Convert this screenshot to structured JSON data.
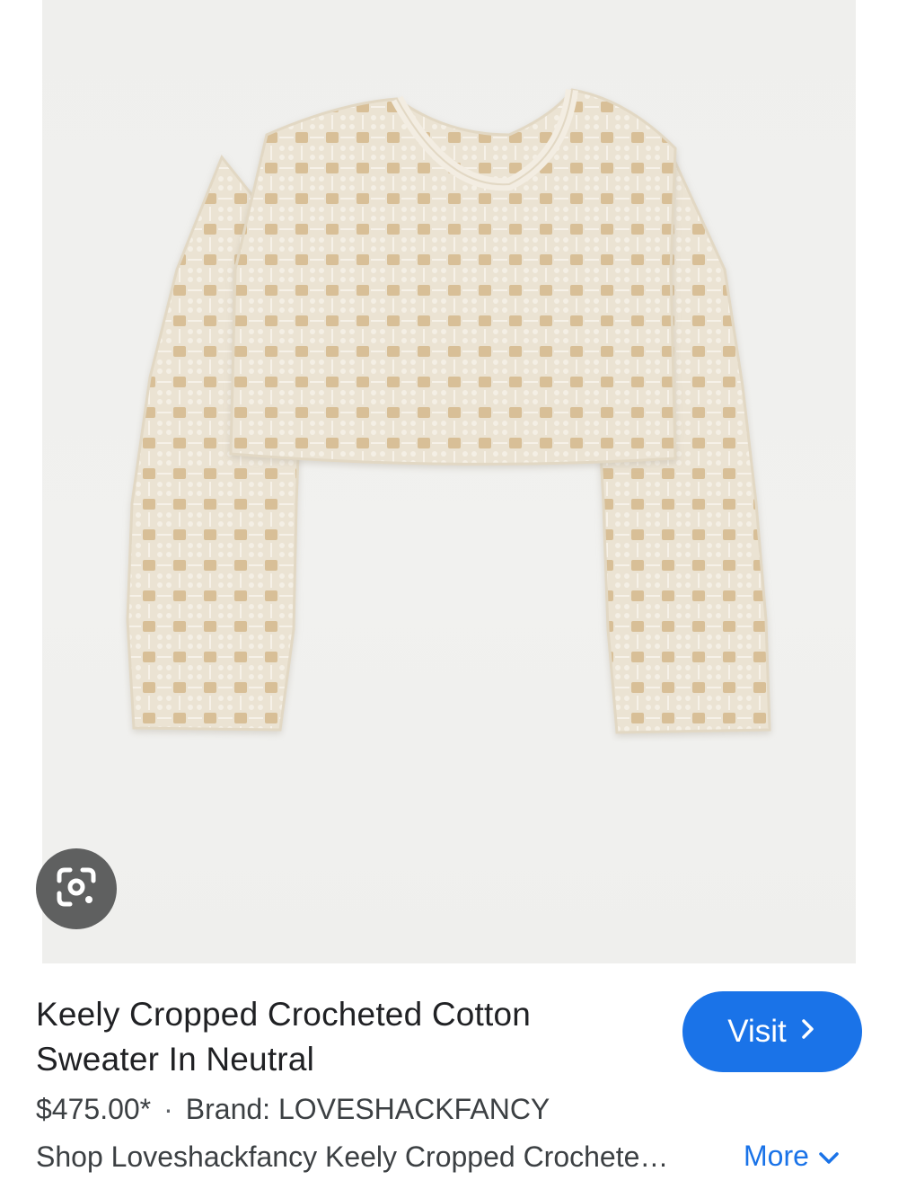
{
  "product": {
    "title": "Keely Cropped Crocheted Cotton Sweater In Neutral",
    "price": "$475.00*",
    "separator": "·",
    "brand": "Brand: LOVESHACKFANCY",
    "description": "Shop Loveshackfancy Keely Cropped Crochete…"
  },
  "actions": {
    "visit_label": "Visit",
    "more_label": "More"
  },
  "icons": {
    "lens": "google-lens-icon",
    "visit_chevron": "chevron-right-icon",
    "more_chevron": "chevron-down-icon"
  },
  "colors": {
    "accent": "#1a73e8",
    "photo_background": "#efefed",
    "garment": "#ece4d4",
    "lens_button": "#5f6060"
  }
}
